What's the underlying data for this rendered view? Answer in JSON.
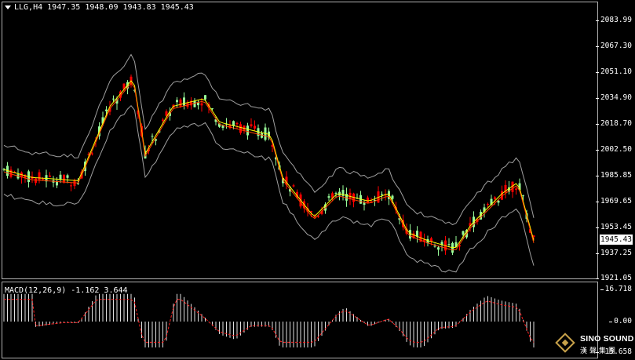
{
  "header": {
    "symbol": "LLG,H4",
    "ohlc": "1947.35 1948.09 1943.83 1945.43"
  },
  "macd_header": {
    "label": "MACD(12,26,9) -1.162 3.644"
  },
  "price_axis": {
    "ticks": [
      "2083.99",
      "2067.30",
      "2051.10",
      "2034.90",
      "2018.70",
      "2002.50",
      "1985.85",
      "1969.65",
      "1953.45",
      "1937.25",
      "1921.05"
    ],
    "current_price": "1945.43"
  },
  "macd_axis": {
    "ticks": [
      "16.718",
      "0.00",
      "-15.658"
    ]
  },
  "logo": {
    "name": "SINO SOUND",
    "cjk": "漢聲集團"
  },
  "colors": {
    "bull": "#ffffff",
    "bear": "#ff0000",
    "upcandle_body": "#98fb98",
    "bollinger": "#a0a0a0",
    "ma_fast": "#ffff00",
    "ma_slow": "#ff4500",
    "macd_hist": "#e0e0e0",
    "macd_signal": "#ff2020"
  },
  "chart_data": {
    "type": "candlestick",
    "price_range": [
      1921.05,
      2083.99
    ],
    "macd_range": [
      -15.658,
      16.718
    ],
    "last_close": 1945.43
  }
}
